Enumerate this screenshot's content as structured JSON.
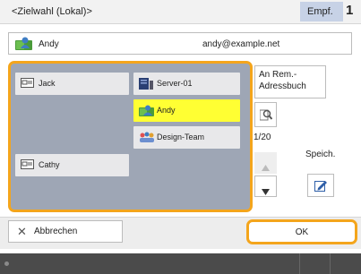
{
  "header": {
    "title": "<Zielwahl (Lokal)>",
    "empf_label": "Empf.",
    "count": "1"
  },
  "selected": {
    "name": "Andy",
    "email": "andy@example.net"
  },
  "entries": [
    {
      "label": "Jack",
      "icon": "fax-icon"
    },
    {
      "label": "Server-01",
      "icon": "server-icon"
    },
    {
      "label": "Andy",
      "icon": "user-icon",
      "selected": true
    },
    {
      "label": "Design-Team",
      "icon": "group-icon"
    },
    {
      "label": "Cathy",
      "icon": "fax-icon"
    }
  ],
  "side": {
    "remote_addressbook": "An Rem.-Adressbuch",
    "pager": "1/20",
    "speich": "Speich."
  },
  "footer": {
    "cancel": "Abbrechen",
    "ok": "OK"
  },
  "colors": {
    "accent": "#f4a51c",
    "selected": "#ffff33",
    "grid_bg": "#9ea6b5",
    "empf_bg": "#c7d2e6"
  }
}
